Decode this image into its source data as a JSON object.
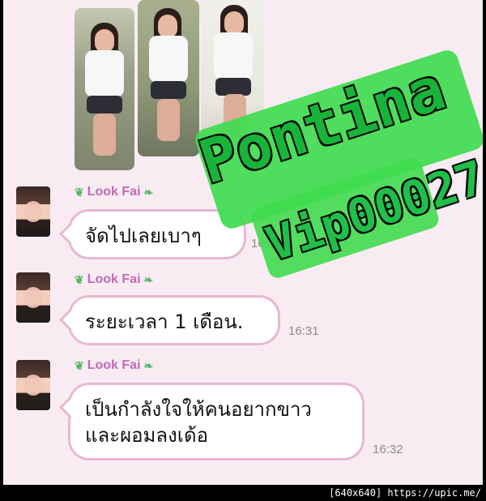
{
  "photos": [
    {
      "label": "photo-1"
    },
    {
      "label": "photo-2"
    },
    {
      "label": "photo-3"
    }
  ],
  "watermark": {
    "line1": "Pontina",
    "line2": "Vip00027"
  },
  "messages": [
    {
      "sender": "Look Fai",
      "text_lines": [
        "จัดไปเลยเบาๆ"
      ],
      "time": "16:31"
    },
    {
      "sender": "Look Fai",
      "text_lines": [
        "ระยะเวลา 1 เดือน."
      ],
      "time": "16:31"
    },
    {
      "sender": "Look Fai",
      "text_lines": [
        "เป็นกำลังใจให้คนอยากขาว",
        "และผอมลงเด้อ"
      ],
      "time": "16:32"
    }
  ],
  "footer": {
    "text": "[640x640] https://upic.me/"
  },
  "colors": {
    "background": "#f8ecf2",
    "bubble_border": "#e8b7d1",
    "sender": "#c16ab9",
    "leaf": "#59b66c",
    "watermark": "#1fbf49"
  },
  "icons": {
    "leaf_left": "leaf-icon",
    "leaf_right": "leaf-icon"
  }
}
